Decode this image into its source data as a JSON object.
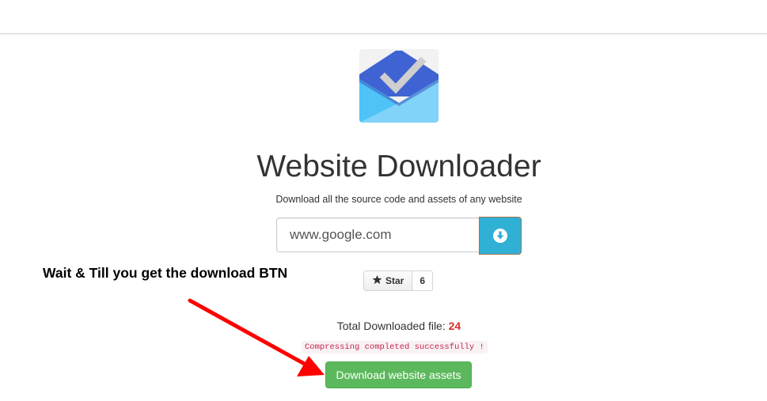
{
  "header": {},
  "logo": {
    "icon": "inbox-envelope-checkmark-logo",
    "colors": {
      "envelope_top": "#3f63d3",
      "envelope_bottom": "#81d3f9",
      "envelope_side": "#4fc3f7",
      "check": "#cccccc"
    }
  },
  "hero": {
    "title": "Website Downloader",
    "subtitle": "Download all the source code and assets of any website"
  },
  "search": {
    "value": "www.google.com",
    "placeholder": "www.google.com",
    "submit_icon": "download-circle-icon",
    "button_color": "#31b0d5"
  },
  "annotation": {
    "text": "Wait & Till you get the download BTN",
    "arrow_color": "#ff0000"
  },
  "github_star": {
    "label": "Star",
    "count": "6",
    "icon": "star-icon"
  },
  "stats": {
    "label": "Total Downloaded file: ",
    "count": "24",
    "count_color": "#d9302c"
  },
  "status": {
    "message": "Compressing completed successfully !"
  },
  "download": {
    "label": "Download website assets",
    "color": "#5cb85c"
  }
}
